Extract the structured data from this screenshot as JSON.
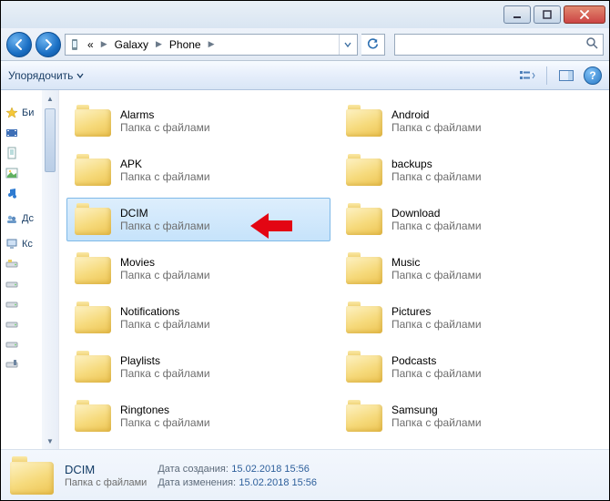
{
  "chrome": {
    "min": "_",
    "max": "▢",
    "close": "✕"
  },
  "address": {
    "seg0": "«",
    "seg1": "Galaxy",
    "seg2": "Phone"
  },
  "toolbar": {
    "organize": "Упорядочить"
  },
  "sidebar": {
    "fav_label": "Би",
    "computer_label": "Кс",
    "home_label": "Дс"
  },
  "subtitle": "Папка с файлами",
  "folders": [
    {
      "name": "Alarms"
    },
    {
      "name": "Android"
    },
    {
      "name": "APK"
    },
    {
      "name": "backups"
    },
    {
      "name": "DCIM",
      "selected": true
    },
    {
      "name": "Download"
    },
    {
      "name": "Movies"
    },
    {
      "name": "Music"
    },
    {
      "name": "Notifications"
    },
    {
      "name": "Pictures"
    },
    {
      "name": "Playlists"
    },
    {
      "name": "Podcasts"
    },
    {
      "name": "Ringtones"
    },
    {
      "name": "Samsung"
    }
  ],
  "details": {
    "name": "DCIM",
    "type": "Папка с файлами",
    "created_label": "Дата создания:",
    "created_value": "15.02.2018 15:56",
    "modified_label": "Дата изменения:",
    "modified_value": "15.02.2018 15:56"
  }
}
